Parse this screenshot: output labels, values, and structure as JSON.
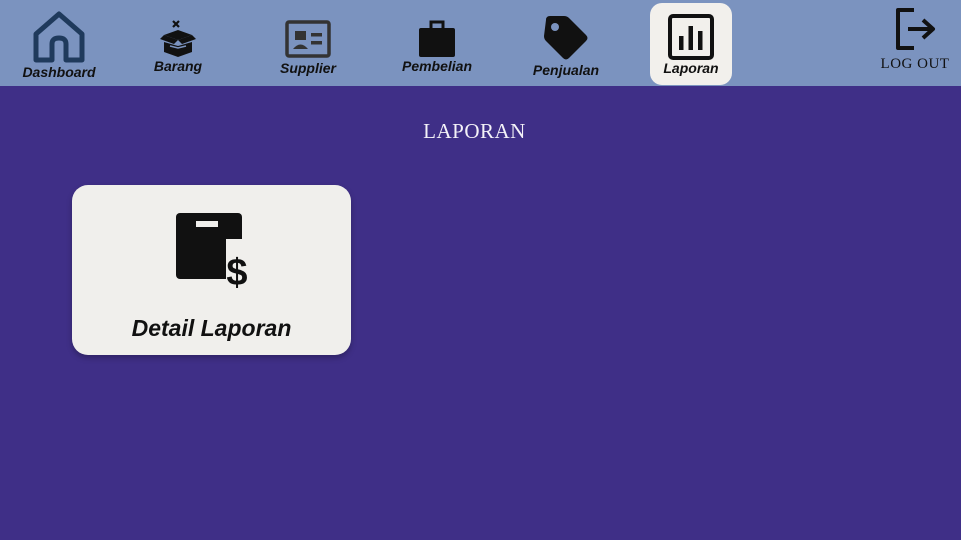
{
  "nav": {
    "items": [
      {
        "label": "Dashboard",
        "icon": "home-icon"
      },
      {
        "label": "Barang",
        "icon": "box-icon"
      },
      {
        "label": "Supplier",
        "icon": "id-card-icon"
      },
      {
        "label": "Pembelian",
        "icon": "shopping-bag-icon"
      },
      {
        "label": "Penjualan",
        "icon": "price-tag-icon"
      },
      {
        "label": "Laporan",
        "icon": "bar-chart-icon"
      }
    ],
    "active": "Laporan",
    "logout_label": "LOG OUT",
    "logout_icon": "logout-icon"
  },
  "main": {
    "title": "LAPORAN",
    "cards": [
      {
        "label": "Detail Laporan",
        "icon": "ledger-dollar-icon"
      }
    ]
  },
  "colors": {
    "background": "#3f2f87",
    "topbar": "#7b93bf",
    "active_tab": "#f2f0ec",
    "card": "#f0efec",
    "home_icon": "#1f3a5c"
  }
}
